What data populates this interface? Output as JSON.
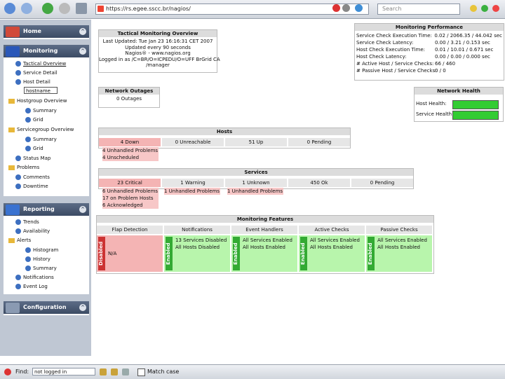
{
  "browser": {
    "url": "https://rs.egee.sscc.br/nagios/",
    "search_placeholder": "Search"
  },
  "sidebar": {
    "home_label": "Home",
    "monitoring_label": "Monitoring",
    "monitoring_items": [
      "Tactical Overview",
      "Service Detail",
      "Host Detail",
      "Hostgroup Overview",
      "Summary",
      "Grid",
      "Servicegroup Overview",
      "Summary",
      "Grid",
      "Status Map",
      "Problems",
      "Comments",
      "Downtime"
    ],
    "name_field_value": "hostname",
    "reporting_label": "Reporting",
    "reporting_items": [
      "Trends",
      "Availability",
      "Alerts",
      "Histogram",
      "History",
      "Summary",
      "Notifications",
      "Event Log"
    ],
    "configuration_label": "Configuration"
  },
  "overview": {
    "title": "Tactical Monitoring Overview",
    "lines": [
      "Last Updated: Tue Jan 23 16:16:31 CET 2007",
      "Updated every 90 seconds",
      "Nagios® - www.nagios.org",
      "Logged in as /C=BR/O=ICPEDU/O=UFF BrGrid CA",
      "/manager"
    ]
  },
  "performance": {
    "title": "Monitoring Performance",
    "rows": [
      {
        "label": "Service Check Execution Time:",
        "value": "0.02 / 2066.35 / 44.042 sec"
      },
      {
        "label": "Service Check Latency:",
        "value": "0.00 / 3.21 / 0.153 sec"
      },
      {
        "label": "Host Check Execution Time:",
        "value": "0.01 / 10.01 / 0.671 sec"
      },
      {
        "label": "Host Check Latency:",
        "value": "0.00 / 0.00 / 0.000 sec"
      },
      {
        "label": "# Active Host / Service Checks:",
        "value": "66 / 460"
      },
      {
        "label": "# Passive Host / Service Checks:",
        "value": "0 / 0"
      }
    ]
  },
  "outages": {
    "title": "Network Outages",
    "value": "0 Outages"
  },
  "health": {
    "title": "Network Health",
    "host_label": "Host Health:",
    "service_label": "Service Health:"
  },
  "hosts": {
    "title": "Hosts",
    "headers": [
      "4 Down",
      "0 Unreachable",
      "51 Up",
      "0 Pending"
    ],
    "details": [
      "4 Unhandled Problems",
      "4 Unscheduled"
    ]
  },
  "services": {
    "title": "Services",
    "headers": [
      "23 Critical",
      "1 Warning",
      "1 Unknown",
      "450 Ok",
      "0 Pending"
    ],
    "critical_details": [
      "6 Unhandled Problems",
      "17 on Problem Hosts",
      "6 Acknowledged"
    ],
    "warning_details": [
      "1 Unhandled Problems"
    ],
    "unknown_details": [
      "1 Unhandled Problems"
    ]
  },
  "features": {
    "title": "Monitoring Features",
    "headers": [
      "Flap Detection",
      "Notifications",
      "Event Handlers",
      "Active Checks",
      "Passive Checks"
    ],
    "states": [
      "Disabled",
      "Enabled",
      "Enabled",
      "Enabled",
      "Enabled"
    ],
    "details": [
      [
        "N/A"
      ],
      [
        "13 Services Disabled",
        "All Hosts Disabled"
      ],
      [
        "All Services Enabled",
        "All Hosts Enabled"
      ],
      [
        "All Services Enabled",
        "All Hosts Enabled"
      ],
      [
        "All Services Enabled",
        "All Hosts Enabled"
      ]
    ]
  },
  "findbar": {
    "find_label": "Find:",
    "find_value": "not logged in",
    "match_case_label": "Match case"
  },
  "colors": {
    "critical": "#f4b4b4",
    "ok": "#b8f5ac",
    "health_bar": "#33cc33",
    "header_bar": "#3c4b64"
  }
}
